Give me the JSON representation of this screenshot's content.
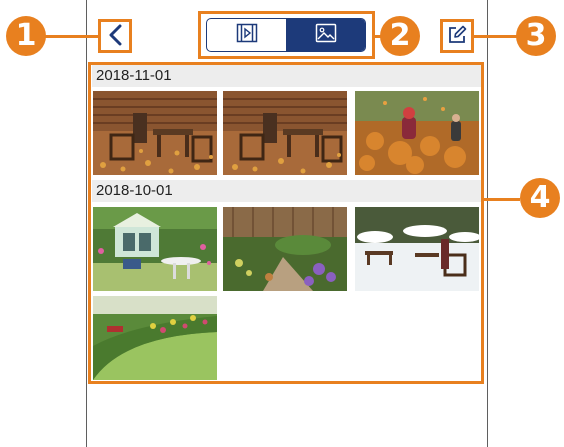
{
  "callouts": {
    "back": "1",
    "view_toggle": "2",
    "edit": "3",
    "content": "4"
  },
  "header": {
    "back_icon": "chevron-left-icon",
    "toggle": {
      "video_icon": "video-clip-icon",
      "photo_icon": "photo-icon",
      "active": "photo"
    },
    "edit_icon": "edit-icon"
  },
  "groups": [
    {
      "date": "2018-11-01",
      "photos": [
        "autumn-patio-chairs-1",
        "autumn-patio-chairs-2",
        "leaf-pile-kids"
      ]
    },
    {
      "date": "2018-10-01",
      "photos": [
        "summerhouse-garden",
        "garden-path-flowers",
        "snowy-patio",
        "lawn-curve-garden"
      ]
    }
  ],
  "colors": {
    "accent": "#e8801f",
    "toggle_active": "#1d3a7a",
    "date_bar": "#ededed"
  }
}
